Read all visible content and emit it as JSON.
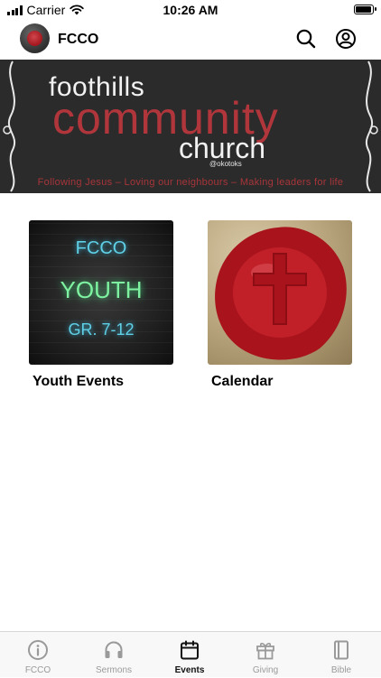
{
  "status_bar": {
    "carrier": "Carrier",
    "time": "10:26 AM",
    "battery_level": 1.0
  },
  "header": {
    "title": "FCCO"
  },
  "banner": {
    "word1": "foothills",
    "word2": "community",
    "word3": "church",
    "place": "@okotoks",
    "tagline": "Following Jesus – Loving our neighbours – Making leaders for life"
  },
  "cards": [
    {
      "label": "Youth Events",
      "image_lines": [
        "FCCO",
        "YOUTH",
        "GR. 7-12"
      ]
    },
    {
      "label": "Calendar"
    }
  ],
  "tabs": [
    {
      "label": "FCCO",
      "icon": "info-icon",
      "active": false
    },
    {
      "label": "Sermons",
      "icon": "headphones-icon",
      "active": false
    },
    {
      "label": "Events",
      "icon": "calendar-icon",
      "active": true
    },
    {
      "label": "Giving",
      "icon": "gift-icon",
      "active": false
    },
    {
      "label": "Bible",
      "icon": "book-icon",
      "active": false
    }
  ],
  "colors": {
    "brand_red": "#b0363c",
    "active_tab": "#111111",
    "inactive_tab": "#9a9a9a"
  }
}
